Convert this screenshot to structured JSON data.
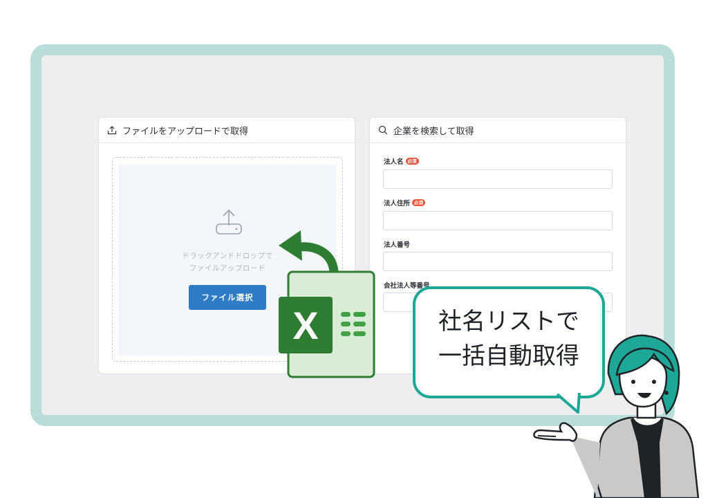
{
  "upload_panel": {
    "title": "ファイルをアップロードで取得",
    "drop_line1": "ドラックアンドドロップで",
    "drop_line2": "ファイルアップロード",
    "button_label": "ファイル選択"
  },
  "search_panel": {
    "title": "企業を検索して取得",
    "required_badge": "必須",
    "fields": [
      {
        "label": "法人名",
        "required": true
      },
      {
        "label": "法人住所",
        "required": true
      },
      {
        "label": "法人番号",
        "required": false
      },
      {
        "label": "会社法人等番号",
        "required": false
      }
    ]
  },
  "excel_icon": {
    "letter": "X"
  },
  "bubble": {
    "line1": "社名リストで",
    "line2": "一括自動取得"
  },
  "colors": {
    "frame": "#b9ddd8",
    "primary_button": "#2f7cc6",
    "required": "#e8533b",
    "excel_green": "#2e7d32",
    "bubble_border": "#1ea797"
  }
}
